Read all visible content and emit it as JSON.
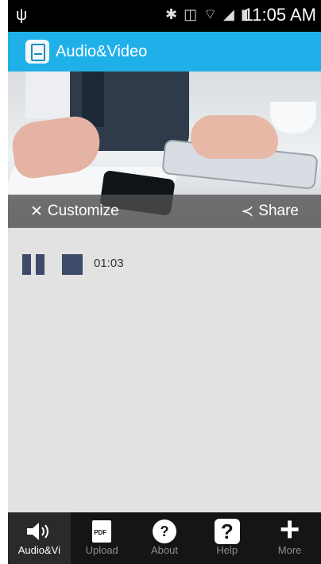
{
  "status_bar": {
    "time": "11:05 AM"
  },
  "app_bar": {
    "title": "Audio&Video"
  },
  "actions": {
    "customize": "Customize",
    "share": "Share"
  },
  "player": {
    "elapsed": "01:03"
  },
  "bottom_nav": {
    "items": [
      {
        "label": "Audio&Vi",
        "icon": "speaker-icon"
      },
      {
        "label": "Upload",
        "icon": "pdf-icon",
        "pdf_text": "PDF"
      },
      {
        "label": "About",
        "icon": "info-question-icon",
        "glyph": "?"
      },
      {
        "label": "Help",
        "icon": "help-question-icon",
        "glyph": "?"
      },
      {
        "label": "More",
        "icon": "plus-icon",
        "glyph": "+"
      }
    ]
  },
  "colors": {
    "app_bar": "#1fb0ea",
    "player_controls": "#3d4a6a",
    "content_bg": "#e2e2e2",
    "bottom_nav": "#151515"
  }
}
